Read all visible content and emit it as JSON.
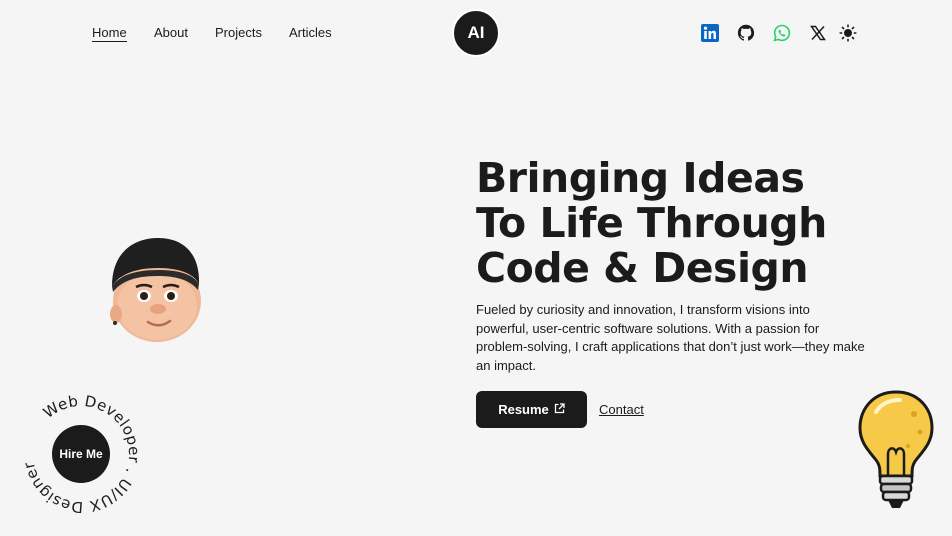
{
  "nav": {
    "links": [
      {
        "label": "Home",
        "active": true
      },
      {
        "label": "About",
        "active": false
      },
      {
        "label": "Projects",
        "active": false
      },
      {
        "label": "Articles",
        "active": false
      }
    ],
    "logo_text": "AI",
    "social_icons": [
      "linkedin-icon",
      "github-icon",
      "whatsapp-icon",
      "x-icon",
      "theme-toggle-icon"
    ]
  },
  "hero": {
    "headline_lines": [
      "Bringing Ideas",
      "To Life Through",
      "Code & Design"
    ],
    "description": "Fueled by curiosity and innovation, I transform visions into powerful, user-centric software solutions. With a passion for problem-solving, I craft applications that don’t just work—they make an impact.",
    "resume_label": "Resume",
    "contact_label": "Contact"
  },
  "hire": {
    "button_label": "Hire Me",
    "ring_text": "Web Developer . UI/UX Designer ."
  },
  "colors": {
    "background": "#f5f5f5",
    "dark": "#1b1b1b",
    "linkedin": "#0a66c2",
    "whatsapp": "#25d366",
    "bulb": "#f7c948"
  }
}
